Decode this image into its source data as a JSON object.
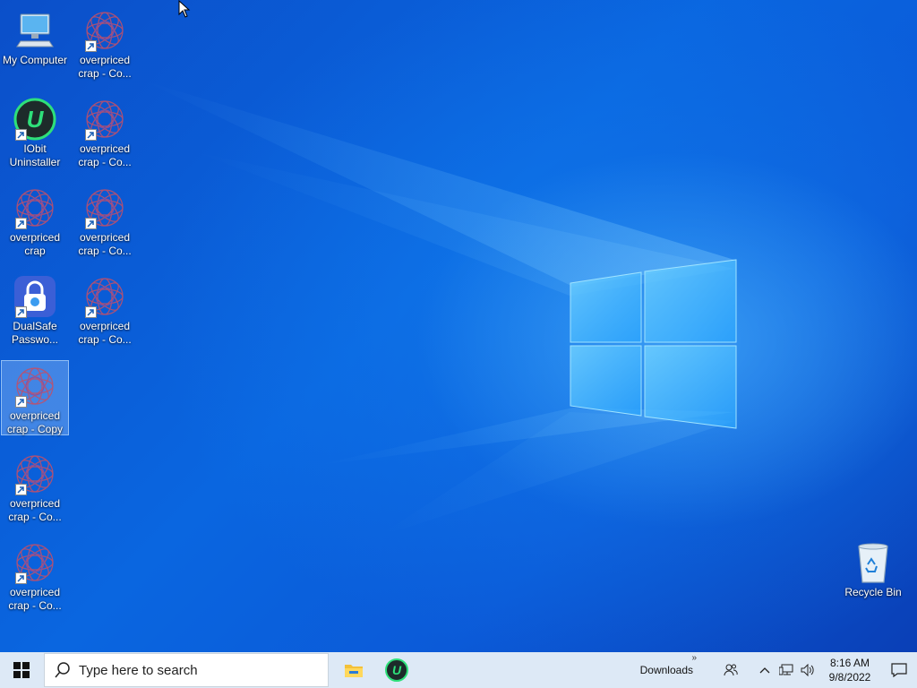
{
  "desktop": {
    "icons": [
      {
        "label": "My Computer",
        "kind": "computer"
      },
      {
        "label": "overpriced\ncrap - Co...",
        "kind": "flower"
      },
      {
        "label": "IObit\nUninstaller",
        "kind": "iobit"
      },
      {
        "label": "overpriced\ncrap - Co...",
        "kind": "flower"
      },
      {
        "label": "overpriced\ncrap",
        "kind": "flower"
      },
      {
        "label": "overpriced\ncrap - Co...",
        "kind": "flower"
      },
      {
        "label": "DualSafe\nPasswo...",
        "kind": "lock"
      },
      {
        "label": "overpriced\ncrap - Co...",
        "kind": "flower"
      },
      {
        "label": "overpriced\ncrap - Copy",
        "kind": "flower"
      },
      {
        "label": "overpriced\ncrap - Co...",
        "kind": "flower"
      },
      {
        "label": "overpriced\ncrap - Co...",
        "kind": "flower"
      },
      {
        "label": "Recycle Bin",
        "kind": "bin"
      }
    ]
  },
  "taskbar": {
    "search_placeholder": "Type here to search",
    "toolbar_label": "Downloads",
    "toolbar_chevron": "»",
    "clock_time": "8:16 AM",
    "clock_date": "9/8/2022",
    "colors": {
      "taskbar_bg": "#dde9f6",
      "iobit_green": "#2ee07a",
      "accent": "#0a66e0"
    }
  }
}
